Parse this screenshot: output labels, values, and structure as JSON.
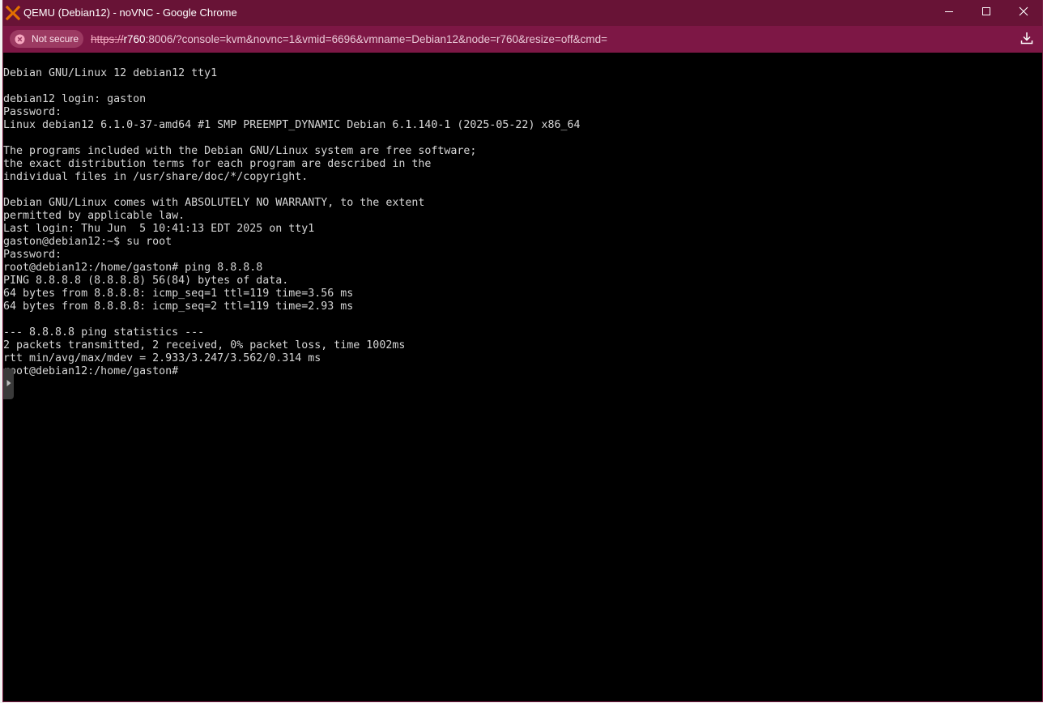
{
  "window": {
    "title": "QEMU (Debian12) - noVNC - Google Chrome",
    "icon": "proxmox-x-icon",
    "controls": [
      "minimize-icon",
      "maximize-icon",
      "close-icon"
    ]
  },
  "address_bar": {
    "security_label": "Not secure",
    "url_scheme": "https://",
    "url_host": "r760",
    "url_rest": ":8006/?console=kvm&novnc=1&vmid=6696&vmname=Debian12&node=r760&resize=off&cmd=",
    "download_icon": "download-icon"
  },
  "console": {
    "lines": [
      "Debian GNU/Linux 12 debian12 tty1",
      "",
      "debian12 login: gaston",
      "Password:",
      "Linux debian12 6.1.0-37-amd64 #1 SMP PREEMPT_DYNAMIC Debian 6.1.140-1 (2025-05-22) x86_64",
      "",
      "The programs included with the Debian GNU/Linux system are free software;",
      "the exact distribution terms for each program are described in the",
      "individual files in /usr/share/doc/*/copyright.",
      "",
      "Debian GNU/Linux comes with ABSOLUTELY NO WARRANTY, to the extent",
      "permitted by applicable law.",
      "Last login: Thu Jun  5 10:41:13 EDT 2025 on tty1",
      "gaston@debian12:~$ su root",
      "Password:",
      "root@debian12:/home/gaston# ping 8.8.8.8",
      "PING 8.8.8.8 (8.8.8.8) 56(84) bytes of data.",
      "64 bytes from 8.8.8.8: icmp_seq=1 ttl=119 time=3.56 ms",
      "64 bytes from 8.8.8.8: icmp_seq=2 ttl=119 time=2.93 ms",
      "",
      "--- 8.8.8.8 ping statistics ---",
      "2 packets transmitted, 2 received, 0% packet loss, time 1002ms",
      "rtt min/avg/max/mdev = 2.933/3.247/3.562/0.314 ms",
      "root@debian12:/home/gaston#"
    ],
    "sidebar_handle_icon": "chevron-right-icon"
  },
  "colors": {
    "titlebar": "#681336",
    "addressbar": "#7d1745",
    "terminal_bg": "#000000",
    "terminal_fg": "#d6d6d6"
  }
}
